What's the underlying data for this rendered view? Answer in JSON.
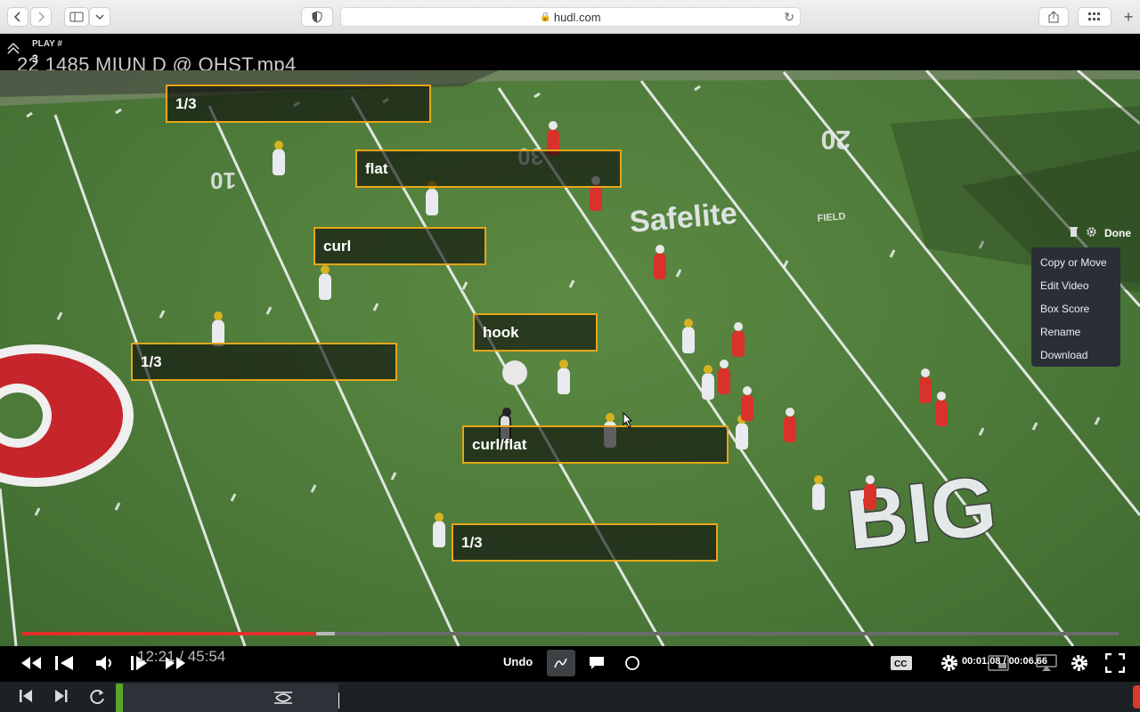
{
  "browser": {
    "url": "hudl.com"
  },
  "header": {
    "play_label": "PLAY #",
    "play_number": "3",
    "title": "22 1485 MIUN D @ OHST.mp4"
  },
  "zones": [
    {
      "label": "1/3"
    },
    {
      "label": "flat"
    },
    {
      "label": "curl"
    },
    {
      "label": "hook"
    },
    {
      "label": "1/3"
    },
    {
      "label": "curl/flat"
    },
    {
      "label": "1/3"
    }
  ],
  "field_text": {
    "sponsor": "Safelite",
    "sponsor_sub": "FIELD",
    "conference": "BIG",
    "yard_20": "20",
    "yard_30": "30",
    "yard_10": "10"
  },
  "edit_panel": {
    "done_label": "Done",
    "menu_items": [
      "Copy or Move",
      "Edit Video",
      "Box Score",
      "Rename",
      "Download"
    ]
  },
  "player_controls": {
    "time_display": "12:21 / 45:54",
    "progress": 0.269,
    "undo_label": "Undo",
    "clip_time": "00:01.08 / 00:06.66"
  },
  "colors": {
    "zone_border": "#e6a519",
    "progress": "#e0302b",
    "playhead": "#5aa62a",
    "menu_bg": "#2a2f36"
  }
}
